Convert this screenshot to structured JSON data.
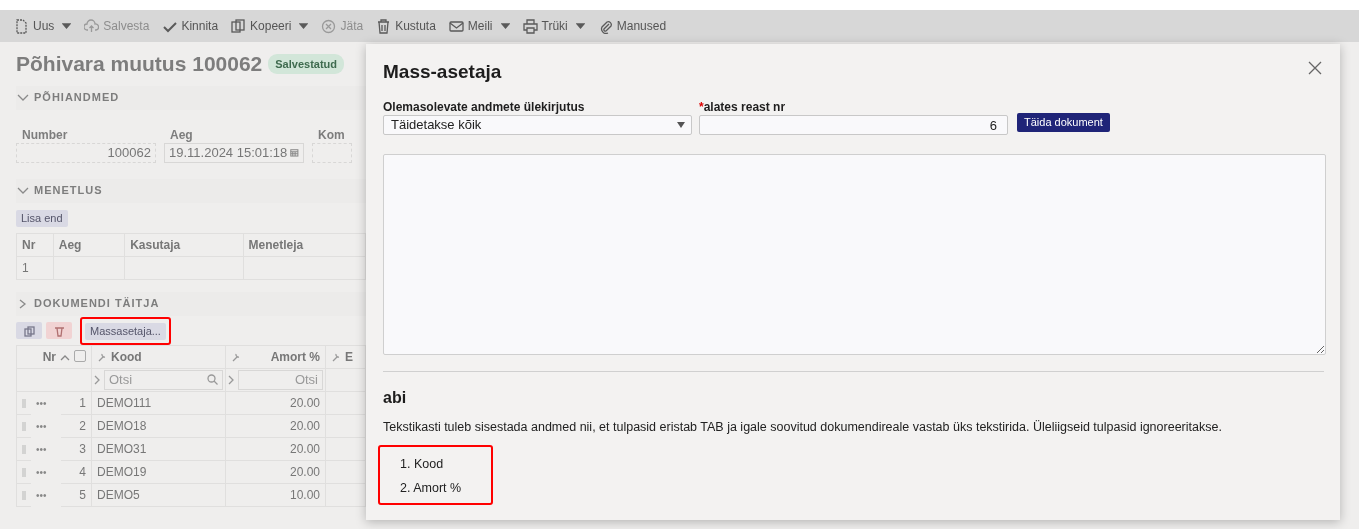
{
  "toolbar": [
    {
      "label": "Uus",
      "disabled": false,
      "dropdown": true
    },
    {
      "label": "Salvesta",
      "disabled": true,
      "dropdown": false
    },
    {
      "label": "Kinnita",
      "disabled": false,
      "dropdown": false
    },
    {
      "label": "Kopeeri",
      "disabled": false,
      "dropdown": true
    },
    {
      "label": "Jäta",
      "disabled": true,
      "dropdown": false
    },
    {
      "label": "Kustuta",
      "disabled": false,
      "dropdown": false
    },
    {
      "label": "Meili",
      "disabled": false,
      "dropdown": true
    },
    {
      "label": "Trüki",
      "disabled": false,
      "dropdown": true
    },
    {
      "label": "Manused",
      "disabled": false,
      "dropdown": false
    }
  ],
  "page": {
    "title": "Põhivara muutus 100062",
    "status_badge": "Salvestatud"
  },
  "pohiandmed": {
    "heading": "PÕHIANDMED",
    "expanded": true,
    "fields": [
      {
        "label": "Number",
        "value": "100062",
        "kind": "text"
      },
      {
        "label": "Aeg",
        "value": "19.11.2024 15:01:18",
        "kind": "date"
      },
      {
        "label": "Kom",
        "kind": "text"
      }
    ]
  },
  "menetlus": {
    "heading": "MENETLUS",
    "expanded": true,
    "add_button": "Lisa end",
    "columns": [
      "Nr",
      "Aeg",
      "Kasutaja",
      "Menetleja"
    ],
    "rows": [
      {
        "nr": "1"
      }
    ]
  },
  "dokumendi_taitja": {
    "heading": "DOKUMENDI TÄITJA",
    "expanded": false,
    "mass_button": {
      "label": "Massasetaja...",
      "highlighted": true
    },
    "header_checkbox": {
      "checked": false
    },
    "columns": [
      {
        "label": "Nr",
        "sorted": true
      },
      {
        "label": "Kood",
        "sorted": false
      },
      {
        "label": "Amort %",
        "sorted": false
      },
      {
        "label": "E",
        "sorted": false
      }
    ],
    "filter_placeholders": [
      "Otsi",
      "Otsi"
    ],
    "rows": [
      {
        "menu": "•••",
        "nr": "1",
        "kood": "DEMO111",
        "amort": "20.00"
      },
      {
        "menu": "•••",
        "nr": "2",
        "kood": "DEMO18",
        "amort": "20.00"
      },
      {
        "menu": "•••",
        "nr": "3",
        "kood": "DEMO31",
        "amort": "20.00"
      },
      {
        "menu": "•••",
        "nr": "4",
        "kood": "DEMO19",
        "amort": "20.00"
      },
      {
        "menu": "•••",
        "nr": "5",
        "kood": "DEMO5",
        "amort": "10.00"
      }
    ]
  },
  "modal": {
    "title": "Mass-asetaja",
    "overwrite": {
      "label": "Olemasolevate andmete ülekirjutus",
      "value": "Täidetakse kõik"
    },
    "start_row": {
      "label": "alates reast nr",
      "required_mark": "*",
      "value": "6"
    },
    "fill_button": "Täida dokument",
    "help": {
      "heading": "abi",
      "text": "Tekstikasti tuleb sisestada andmed nii, et tulpasid eristab TAB ja igale soovitud dokumendireale vastab üks tekstirida. Üleliigseid tulpasid ignoreeritakse.",
      "highlighted": true,
      "items": [
        "1. Kood",
        "2. Amort %"
      ]
    }
  }
}
